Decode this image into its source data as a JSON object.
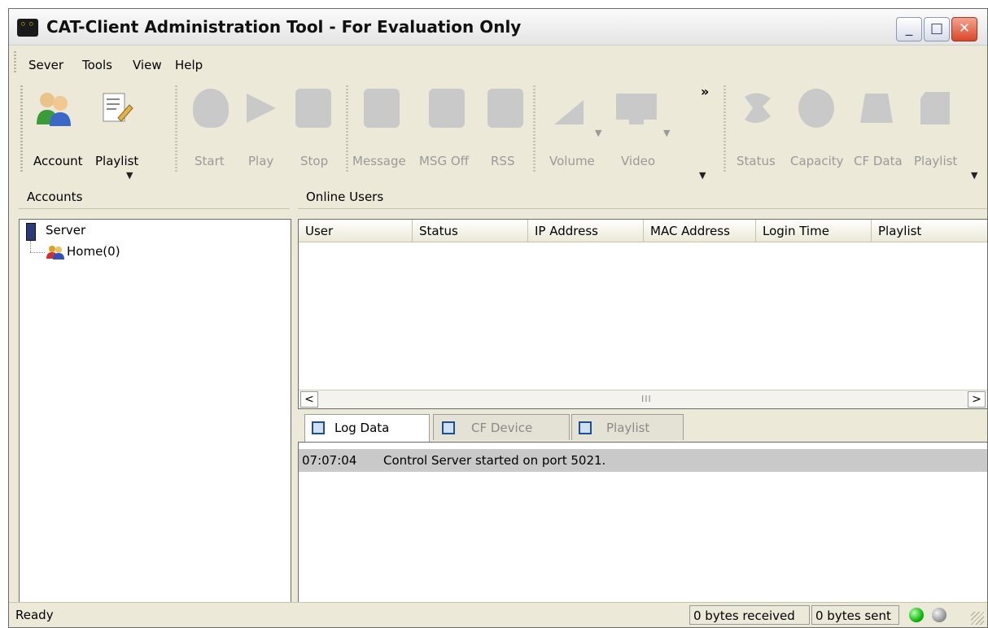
{
  "window": {
    "title": "CAT-Client Administration Tool - For Evaluation Only",
    "controls": {
      "minimize": "_",
      "maximize": "□",
      "close": "✕"
    }
  },
  "menu": [
    "Sever",
    "Tools",
    "View",
    "Help"
  ],
  "toolbar": {
    "groups": [
      {
        "items": [
          {
            "label": "Account",
            "icon": "account-users-icon",
            "enabled": true
          },
          {
            "label": "Playlist",
            "icon": "playlist-edit-icon",
            "enabled": true
          }
        ]
      },
      {
        "items": [
          {
            "label": "Start",
            "icon": "shield-icon",
            "enabled": false
          },
          {
            "label": "Play",
            "icon": "play-icon",
            "enabled": false
          },
          {
            "label": "Stop",
            "icon": "stop-icon",
            "enabled": false
          }
        ]
      },
      {
        "items": [
          {
            "label": "Message",
            "icon": "message-icon",
            "enabled": false
          },
          {
            "label": "MSG Off",
            "icon": "message-off-icon",
            "enabled": false
          },
          {
            "label": "RSS",
            "icon": "rss-icon",
            "enabled": false
          }
        ]
      },
      {
        "items": [
          {
            "label": "Volume",
            "icon": "volume-icon",
            "enabled": false
          },
          {
            "label": "Video",
            "icon": "video-monitor-icon",
            "enabled": false
          }
        ]
      },
      {
        "items": [
          {
            "label": "Status",
            "icon": "status-icon",
            "enabled": false
          },
          {
            "label": "Capacity",
            "icon": "capacity-icon",
            "enabled": false
          },
          {
            "label": "CF Data",
            "icon": "cf-data-icon",
            "enabled": false
          },
          {
            "label": "Playlist",
            "icon": "playlist-icon",
            "enabled": false
          }
        ]
      }
    ],
    "overflow": "»"
  },
  "accounts": {
    "header": "Accounts",
    "tree": [
      {
        "label": "Server",
        "icon": "server-icon"
      },
      {
        "label": "Home(0)",
        "icon": "group-users-icon"
      }
    ]
  },
  "online_users": {
    "header": "Online Users",
    "columns": [
      "User",
      "Status",
      "IP Address",
      "MAC Address",
      "Login Time",
      "Playlist"
    ],
    "rows": []
  },
  "bottom_tabs": [
    {
      "label": "Log Data",
      "active": true,
      "enabled": true
    },
    {
      "label": "CF Device",
      "active": false,
      "enabled": false
    },
    {
      "label": "Playlist",
      "active": false,
      "enabled": false
    }
  ],
  "log": [
    {
      "time": "07:07:04",
      "message": "Control Server started on port 5021."
    }
  ],
  "status": {
    "text": "Ready",
    "received": "0 bytes received",
    "sent": "0 bytes sent",
    "indicators": [
      "green",
      "gray"
    ]
  }
}
